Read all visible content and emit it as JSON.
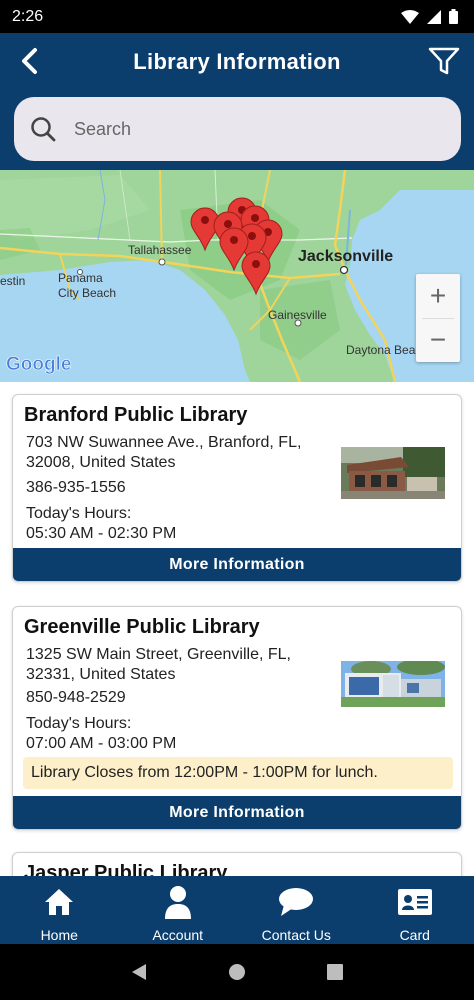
{
  "status_bar": {
    "time": "2:26"
  },
  "app_bar": {
    "title": "Library Information"
  },
  "search": {
    "placeholder": "Search"
  },
  "map": {
    "labels": [
      "Tallahassee",
      "Jacksonville",
      "Panama",
      "City Beach",
      "Gainesville",
      "Daytona Beach",
      "estin"
    ],
    "google_logo": "Google",
    "zoom_in": "+",
    "zoom_out": "−"
  },
  "libraries": [
    {
      "name": "Branford Public Library",
      "address": "703 NW Suwannee Ave., Branford, FL, 32008, United States",
      "phone": "386-935-1556",
      "hours_label": "Today's Hours:",
      "hours": "05:30 AM - 02:30 PM",
      "notice": "",
      "more_label": "More Information"
    },
    {
      "name": "Greenville Public Library",
      "address": "1325 SW Main Street, Greenville, FL, 32331, United States",
      "phone": "850-948-2529",
      "hours_label": "Today's Hours:",
      "hours": "07:00 AM - 03:00 PM",
      "notice": "Library Closes from 12:00PM - 1:00PM for lunch.",
      "more_label": "More Information"
    },
    {
      "name": "Jasper Public Library"
    }
  ],
  "bottom_nav": {
    "items": [
      {
        "label": "Home",
        "icon": "home-icon"
      },
      {
        "label": "Account",
        "icon": "person-icon"
      },
      {
        "label": "Contact Us",
        "icon": "chat-bubble-icon"
      },
      {
        "label": "Card",
        "icon": "id-card-icon"
      }
    ]
  },
  "colors": {
    "primary": "#0b3d6d",
    "notice_bg": "#fdefc9",
    "search_bg": "#e9e6ee",
    "map_land": "#9fd59a",
    "map_water": "#a6d6f2",
    "marker": "#e53935"
  }
}
